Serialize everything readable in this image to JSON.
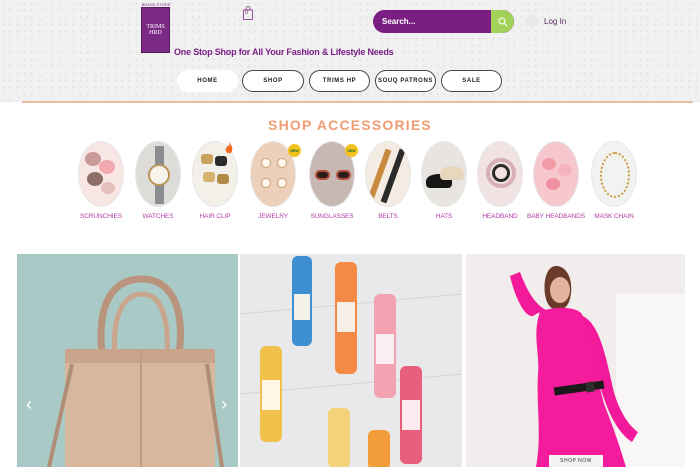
{
  "brand": {
    "logo_top_text": "BRAND STORE",
    "logo_line1": "TRIMS",
    "logo_line2": "HRD",
    "tagline": "One Stop Shop for All Your Fashion & Lifestyle Needs",
    "color": "#7a1e82"
  },
  "cart": {
    "count": "0"
  },
  "search": {
    "placeholder": "Search..."
  },
  "login": {
    "label": "Log In"
  },
  "nav": {
    "items": [
      {
        "label": "HOME",
        "active": true
      },
      {
        "label": "SHOP"
      },
      {
        "label": "TRIMS HP"
      },
      {
        "label": "SOUQ PATRONS"
      },
      {
        "label": "SALE"
      }
    ]
  },
  "accessories": {
    "title": "SHOP ACCESSORIES",
    "title_color": "#f19d73",
    "label_color": "#b03ca6",
    "badge_text": "NEW",
    "categories": [
      {
        "label": "SCRUNCHIES",
        "icon": "scrunchies-image"
      },
      {
        "label": "WATCHES",
        "icon": "watch-image"
      },
      {
        "label": "HAIR CLIP",
        "icon": "hairclip-image"
      },
      {
        "label": "JEWELRY",
        "icon": "jewelry-image",
        "badge": true
      },
      {
        "label": "SUNGLASSES",
        "icon": "sunglasses-image",
        "badge": true
      },
      {
        "label": "BELTS",
        "icon": "belt-image"
      },
      {
        "label": "HATS",
        "icon": "hat-image"
      },
      {
        "label": "HEADBAND",
        "icon": "headband-image"
      },
      {
        "label": "BABY HEADBANDS",
        "icon": "baby-headband-image"
      },
      {
        "label": "MASK CHAIN",
        "icon": "mask-chain-image"
      }
    ]
  },
  "banners": {
    "shop_now": "SHOP NOW",
    "arrow_left": "‹",
    "arrow_right": "›"
  }
}
